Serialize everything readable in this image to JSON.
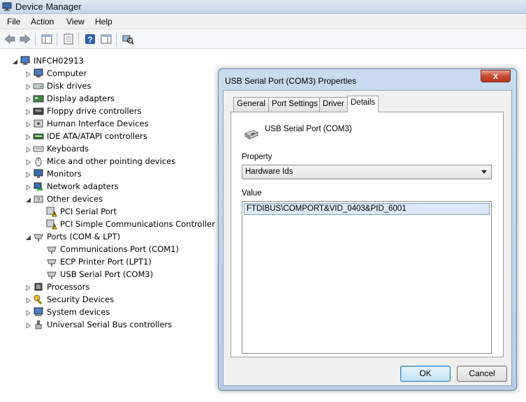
{
  "window": {
    "title": "Device Manager"
  },
  "menu": [
    "File",
    "Action",
    "View",
    "Help"
  ],
  "toolbar": {
    "icons": [
      "back-arrow-icon",
      "forward-arrow-icon",
      "show-hide-console-tree-icon",
      "properties-icon",
      "help-icon",
      "action-pane-icon",
      "scan-hardware-icon"
    ]
  },
  "tree": {
    "root": "INFCH02913",
    "items": [
      {
        "label": "Computer",
        "icon": "computer-icon",
        "expanded": false
      },
      {
        "label": "Disk drives",
        "icon": "disk-drive-icon",
        "expanded": false
      },
      {
        "label": "Display adapters",
        "icon": "display-adapter-icon",
        "expanded": false
      },
      {
        "label": "Floppy drive controllers",
        "icon": "floppy-controller-icon",
        "expanded": false
      },
      {
        "label": "Human Interface Devices",
        "icon": "hid-icon",
        "expanded": false
      },
      {
        "label": "IDE ATA/ATAPI controllers",
        "icon": "ide-controller-icon",
        "expanded": false
      },
      {
        "label": "Keyboards",
        "icon": "keyboard-icon",
        "expanded": false
      },
      {
        "label": "Mice and other pointing devices",
        "icon": "mouse-icon",
        "expanded": false
      },
      {
        "label": "Monitors",
        "icon": "monitor-icon",
        "expanded": false
      },
      {
        "label": "Network adapters",
        "icon": "network-adapter-icon",
        "expanded": false
      },
      {
        "label": "Other devices",
        "icon": "other-devices-icon",
        "expanded": true,
        "children": [
          {
            "label": "PCI Serial Port",
            "icon": "warning-device-icon"
          },
          {
            "label": "PCI Simple Communications Controller",
            "icon": "warning-device-icon"
          }
        ]
      },
      {
        "label": "Ports (COM & LPT)",
        "icon": "port-icon",
        "expanded": true,
        "children": [
          {
            "label": "Communications Port (COM1)",
            "icon": "port-icon"
          },
          {
            "label": "ECP Printer Port (LPT1)",
            "icon": "port-icon"
          },
          {
            "label": "USB Serial Port (COM3)",
            "icon": "port-icon"
          }
        ]
      },
      {
        "label": "Processors",
        "icon": "processor-icon",
        "expanded": false
      },
      {
        "label": "Security Devices",
        "icon": "security-key-icon",
        "expanded": false
      },
      {
        "label": "System devices",
        "icon": "system-devices-icon",
        "expanded": false
      },
      {
        "label": "Universal Serial Bus controllers",
        "icon": "usb-icon",
        "expanded": false
      }
    ]
  },
  "dialog": {
    "title": "USB Serial Port (COM3) Properties",
    "close_label": "x",
    "tabs": [
      {
        "label": "General",
        "active": false
      },
      {
        "label": "Port Settings",
        "active": false
      },
      {
        "label": "Driver",
        "active": false
      },
      {
        "label": "Details",
        "active": true
      }
    ],
    "device_name": "USB Serial Port (COM3)",
    "property_label": "Property",
    "property_selected": "Hardware Ids",
    "value_label": "Value",
    "values": [
      "FTDIBUS\\COMPORT&VID_0403&PID_6001"
    ],
    "ok_label": "OK",
    "cancel_label": "Cancel"
  }
}
